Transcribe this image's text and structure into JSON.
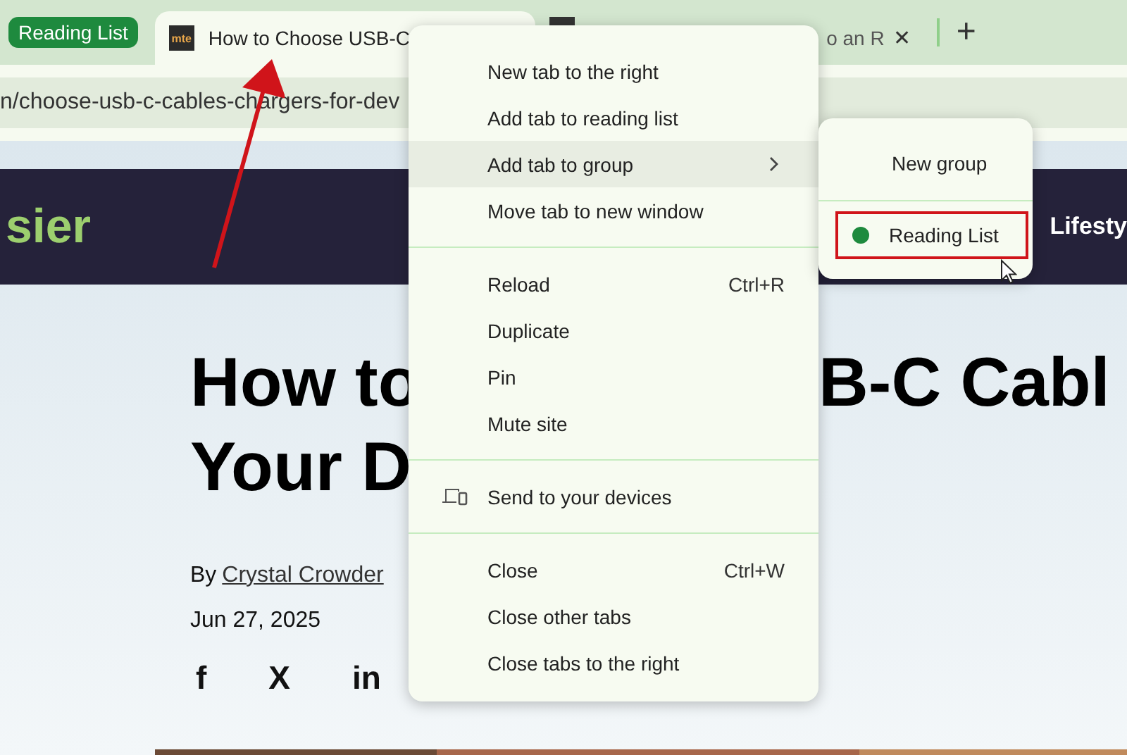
{
  "tab_strip": {
    "group_chip": {
      "label": "Reading List",
      "color": "#1e8a3e"
    },
    "tabs": [
      {
        "icon_text": "mte",
        "title": "How to Choose USB-C",
        "selected": true
      },
      {
        "title": "o an R",
        "selected": false,
        "close_symbol": "✕"
      }
    ],
    "new_tab_symbol": "+"
  },
  "address_bar": {
    "url": "n/choose-usb-c-cables-chargers-for-dev"
  },
  "page": {
    "site_header": {
      "logo_part": "sier",
      "nav_item": "Lifesty"
    },
    "headline_lines": [
      {
        "left": "How to",
        "right": "B-C Cabl"
      },
      {
        "left": "Your D"
      }
    ],
    "byline_prefix": "By",
    "author": "Crystal Crowder",
    "date": "Jun 27, 2025",
    "share_icons": [
      "f",
      "X",
      "in"
    ]
  },
  "context_menu": {
    "items": [
      {
        "kind": "item",
        "label": "New tab to the right",
        "highlighted": false
      },
      {
        "kind": "item",
        "label": "Add tab to reading list",
        "highlighted": false
      },
      {
        "kind": "submenu",
        "label": "Add tab to group",
        "highlighted": true
      },
      {
        "kind": "item",
        "label": "Move tab to new window",
        "highlighted": false
      },
      {
        "kind": "divider"
      },
      {
        "kind": "item",
        "label": "Reload",
        "shortcut": "Ctrl+R",
        "highlighted": false
      },
      {
        "kind": "item",
        "label": "Duplicate",
        "highlighted": false
      },
      {
        "kind": "item",
        "label": "Pin",
        "highlighted": false
      },
      {
        "kind": "item",
        "label": "Mute site",
        "highlighted": false
      },
      {
        "kind": "divider"
      },
      {
        "kind": "item",
        "label": "Send to your devices",
        "has_icon": true,
        "highlighted": false
      },
      {
        "kind": "divider"
      },
      {
        "kind": "item",
        "label": "Close",
        "shortcut": "Ctrl+W",
        "highlighted": false
      },
      {
        "kind": "item",
        "label": "Close other tabs",
        "highlighted": false
      },
      {
        "kind": "item",
        "label": "Close tabs to the right",
        "highlighted": false
      }
    ]
  },
  "submenu": {
    "items": [
      {
        "kind": "action",
        "label": "New group",
        "outlined": false
      },
      {
        "kind": "divider"
      },
      {
        "kind": "group",
        "label": "Reading List",
        "color": "#1e8a3e",
        "outlined": true
      }
    ]
  }
}
